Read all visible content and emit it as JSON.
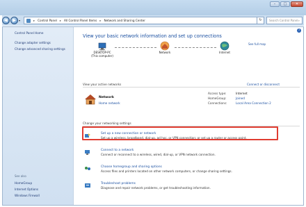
{
  "window": {
    "buttons": {
      "minimize": "–",
      "maximize": "□",
      "close": "✕"
    }
  },
  "navigation": {
    "back": "◀",
    "forward": "▶",
    "dropdown": "▾",
    "breadcrumbs": [
      "Control Panel",
      "All Control Panel Items",
      "Network and Sharing Center"
    ],
    "separator": "▸",
    "refresh": "↻",
    "search_placeholder": "Search Control Panel",
    "search_icon": "⌕"
  },
  "sidebar": {
    "links": [
      "Control Panel Home",
      "Change adapter settings",
      "Change advanced sharing settings"
    ],
    "see_also_heading": "See also",
    "see_also": [
      "HomeGroup",
      "Internet Options",
      "Windows Firewall"
    ]
  },
  "main": {
    "help": "?",
    "title": "View your basic network information and set up connections",
    "see_full_map": "See full map",
    "map": {
      "computer": "DESKTOP-PC",
      "computer_sub": "(This computer)",
      "network": "Network",
      "internet": "Internet"
    },
    "active_networks_label": "View your active networks",
    "connect_disconnect": "Connect or disconnect",
    "network_name": "Network",
    "network_type": "Home network",
    "access_type_label": "Access type:",
    "access_type_value": "Internet",
    "homegroup_label": "HomeGroup:",
    "homegroup_value": "Joined",
    "connections_label": "Connections:",
    "connections_value": "Local Area Connection 2",
    "change_settings_label": "Change your networking settings",
    "tasks": [
      {
        "link": "Set up a new connection or network",
        "desc": "Set up a wireless, broadband, dial-up, ad hoc, or VPN connection; or set up a router or access point."
      },
      {
        "link": "Connect to a network",
        "desc": "Connect or reconnect to a wireless, wired, dial-up, or VPN network connection."
      },
      {
        "link": "Choose homegroup and sharing options",
        "desc": "Access files and printers located on other network computers, or change sharing settings."
      },
      {
        "link": "Troubleshoot problems",
        "desc": "Diagnose and repair network problems, or get troubleshooting information."
      }
    ]
  },
  "colors": {
    "link": "#1a4fa0",
    "highlight": "#e03c31",
    "sidebar_bg": "#d9e6f4"
  }
}
